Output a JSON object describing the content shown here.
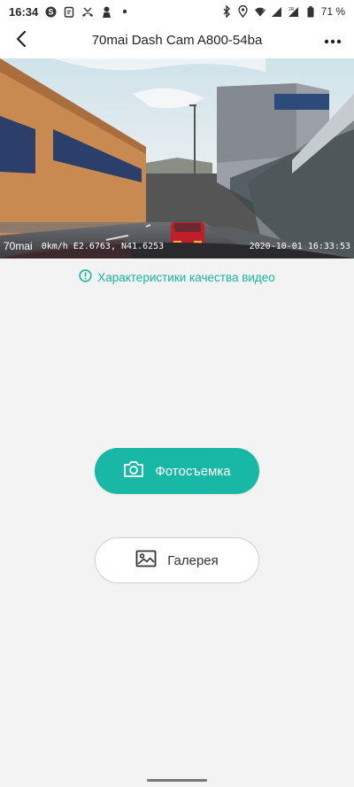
{
  "status_bar": {
    "time": "16:34",
    "battery_percent": "71 %",
    "notification_icons": [
      "skype-icon",
      "clipboard-icon",
      "missed-call-icon",
      "person-icon",
      "dot-icon"
    ],
    "system_icons": [
      "bluetooth-icon",
      "location-icon",
      "wifi-icon",
      "signal-icon",
      "signal-2r-icon",
      "battery-icon"
    ]
  },
  "app_bar": {
    "title": "70mai Dash Cam A800-54ba",
    "back_icon": "back-arrow-icon",
    "more_icon": "more-dots-icon"
  },
  "video": {
    "brand": "70mai",
    "speed": "0km/h",
    "gps": "E2.6763, N41.6253",
    "datetime": "2020-10-01 16:33:53"
  },
  "quality": {
    "label": "Характеристики качества видео",
    "icon": "info-icon",
    "color": "#17b3a3"
  },
  "actions": {
    "photo_label": "Фотосъемка",
    "photo_icon": "camera-icon",
    "gallery_label": "Галерея",
    "gallery_icon": "image-icon"
  },
  "colors": {
    "accent": "#19b7a6",
    "background": "#f3f3f3"
  }
}
